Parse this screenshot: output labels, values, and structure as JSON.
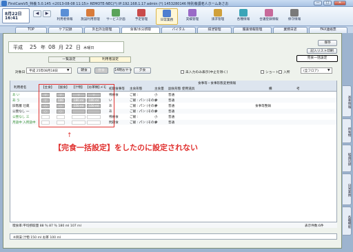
{
  "window": {
    "title": "FirstCareV5_特養 5.0.145 <2013-08-08 11:15> REMOTE-NEC(*) IP:192.168.1.17 admin (*) 1453280146 特別養護老人ホームあさお",
    "min": "—",
    "max": "□",
    "close": "✕"
  },
  "clock": {
    "date": "8月22日",
    "time": "16:41"
  },
  "menu": [
    {
      "label": "利用者情報",
      "icon": "person-icon",
      "color": "#5a8fd6"
    },
    {
      "label": "施設利用管理",
      "icon": "building-icon",
      "color": "#d87b3a"
    },
    {
      "label": "サービス計画",
      "icon": "clipboard-icon",
      "color": "#5aa35a"
    },
    {
      "label": "予定管理",
      "icon": "calendar-icon",
      "color": "#c94b4b"
    },
    {
      "label": "日常業務",
      "icon": "house-icon",
      "color": "#4f7fd0"
    },
    {
      "label": "実績管理",
      "icon": "chart-icon",
      "color": "#9a6ac7"
    },
    {
      "label": "請求管理",
      "icon": "invoice-icon",
      "color": "#d0a03a"
    },
    {
      "label": "各種情報",
      "icon": "info-icon",
      "color": "#3aa5b8"
    },
    {
      "label": "合議登録情報",
      "icon": "group-icon",
      "color": "#c76a9a"
    },
    {
      "label": "保守情報",
      "icon": "tools-icon",
      "color": "#7a7a7a"
    }
  ],
  "tabs": [
    "TOP",
    "ケア記録",
    "外出外泊管理",
    "食事/水分摂取",
    "バイタル",
    "排泄管理",
    "服薬情報管理",
    "業務日誌",
    "FAX連絡票"
  ],
  "side_tabs": [
    "基本情報",
    "所有物",
    "経過記録",
    "日常業務",
    "各種機能"
  ],
  "header": {
    "era": "平成",
    "year": "25",
    "year_unit": "年",
    "month": "08",
    "month_unit": "月",
    "day": "22",
    "day_unit": "日",
    "weekday": "木曜日"
  },
  "buttons": {
    "save": "保存",
    "print": "記入リスト印刷",
    "bulk_complete": "完食一括設定"
  },
  "subtabs": [
    "一覧設定",
    "利用者設定"
  ],
  "filters": {
    "target_date_label": "対象日",
    "target_date_value": "平成 25年08月18日",
    "dropdown_arrow": "▼",
    "meals": [
      "朝食",
      "昼食",
      "14時おやつ",
      "夕食"
    ],
    "unentered_label": "未入力のみ表示(中止を除く)",
    "short_label": "ショート",
    "inhouse_label": "入所",
    "floor_value": "(全フロア)"
  },
  "table": {
    "headers": [
      "利用者名",
      "【主食】",
      "【副食】",
      "【汁物】",
      "【お茶類】",
      "メモ",
      "初期食事等",
      "主食形態",
      "主食量",
      "副食形態",
      "使用道具",
      "備",
      "考"
    ],
    "group_header": "食事等・食事形態変更情報",
    "rows": [
      {
        "name": "あ い",
        "green": true,
        "c1": "▽",
        "c2": "▽",
        "c3": "▽",
        "c4": "▽",
        "type": "嚥療食",
        "form": "ご飯 :",
        "qty": "小",
        "side": "普通",
        "tool": "",
        "note": ""
      },
      {
        "name": "あ う",
        "green": true,
        "c1": "▽",
        "c2": "100",
        "c3": "180 ml",
        "c4": "100 ml",
        "type": "い",
        "form": "ご飯 : パン (そのま",
        "qty": "中",
        "side": "普通",
        "tool": "",
        "note": ""
      },
      {
        "name": "旧階層 壮蔵",
        "green": false,
        "c1": "○",
        "c2": "○",
        "c3": "150 ml",
        "c4": "150 ml",
        "type": "あ",
        "form": "ご飯 : パン (そのま",
        "qty": "中",
        "side": "普通",
        "tool": "",
        "note": "食事等整鍋"
      },
      {
        "name": "公營なし 一",
        "green": false,
        "c1": "○",
        "c2": "○",
        "c3": "",
        "c4": "",
        "type": "あ",
        "form": "ご飯 : パン (そのま",
        "qty": "中",
        "side": "普通",
        "tool": "",
        "note": ""
      },
      {
        "name": "公營なし 三",
        "green": true,
        "c1": "",
        "c2": "",
        "c3": "",
        "c4": "",
        "type": "嚥療食",
        "form": "ご飯 :",
        "qty": "小",
        "side": "普通",
        "tool": "",
        "note": ""
      },
      {
        "name": "月途中 入所途中",
        "green": true,
        "c1": "",
        "c2": "",
        "c3": "",
        "c4": "",
        "type": "問題食",
        "form": "ご飯 : パン (そのま",
        "qty": "中",
        "side": "普通",
        "tool": "",
        "note": ""
      }
    ]
  },
  "annotation": {
    "arrow": "↑",
    "text": "【完食一括設定】をしたのに設定されない"
  },
  "footer": {
    "summary": "喫食率:平均摂取量 88 ％ 87 ％ 180 ml 107 ml",
    "count": "表示件数:6件",
    "target": "※目安:汁物 150 ml お茶 100 ml"
  }
}
